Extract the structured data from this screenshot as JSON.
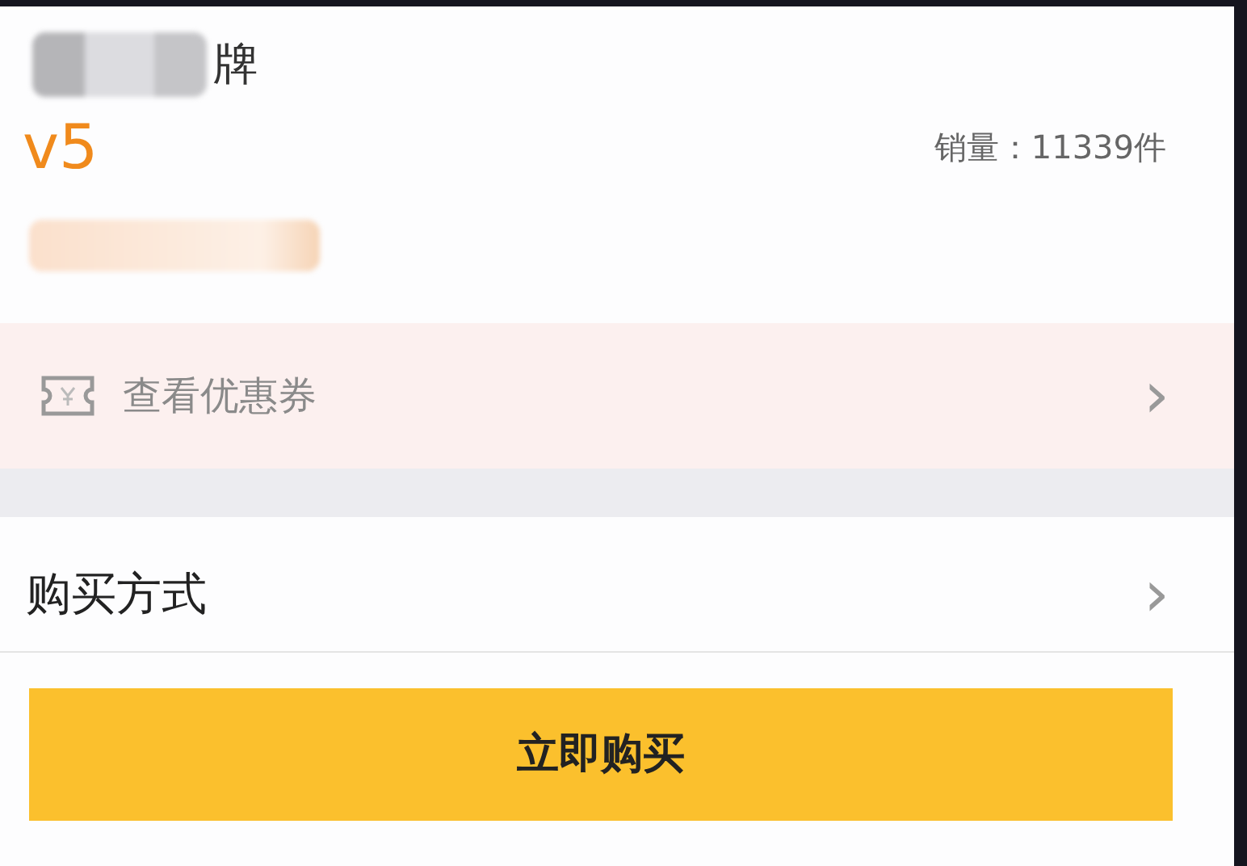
{
  "brand": {
    "name": "牌"
  },
  "level_badge": "v5",
  "sales": "销量：11339件",
  "coupon_row": {
    "label": "查看优惠券",
    "chevron": "›"
  },
  "purchase_row": {
    "label": "购买方式",
    "chevron": "›"
  },
  "buy_button": "立即购买"
}
